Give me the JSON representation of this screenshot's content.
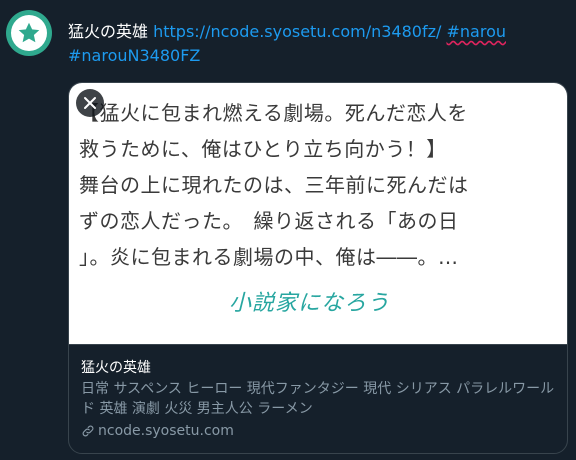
{
  "tweet": {
    "title": "猛火の英雄",
    "link": "https://ncode.syosetu.com/n3480fz/",
    "hashtag1": "#narou",
    "hashtag2": "#narouN3480FZ"
  },
  "card": {
    "image_lines": [
      "【猛火に包まれ燃える劇場。死んだ恋人を",
      "救うために、俺はひとり立ち向かう！】",
      "舞台の上に現れたのは、三年前に死んだは",
      "ずの恋人だった。　繰り返される「あの日",
      "」。炎に包まれる劇場の中、俺は――。…"
    ],
    "logo": "小説家になろう",
    "title": "猛火の英雄",
    "description": "日常 サスペンス ヒーロー 現代ファンタジー 現代 シリアス パラレルワールド 英雄 演劇 火災 男主人公 ラーメン",
    "domain": "ncode.syosetu.com"
  },
  "icons": {
    "avatar": "star-icon",
    "close": "close-icon",
    "link": "link-icon"
  },
  "colors": {
    "background": "#15202b",
    "link": "#1d9bf0",
    "avatar": "#2fa98e",
    "logo": "#27a6a0"
  }
}
